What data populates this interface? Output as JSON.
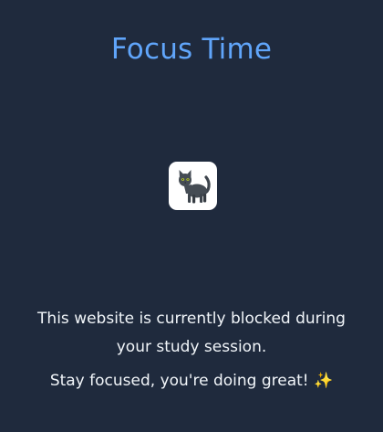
{
  "page": {
    "title": "Focus Time",
    "message": "This website is currently blocked during your study session.",
    "encouragement": "Stay focused, you're doing great!",
    "encouragement_emoji": "✨",
    "illustration_icon": "black-cat-icon"
  },
  "colors": {
    "background": "#1f2a3d",
    "title": "#60a5fa",
    "text": "#f1f5f9",
    "icon_tile": "#ffffff"
  }
}
